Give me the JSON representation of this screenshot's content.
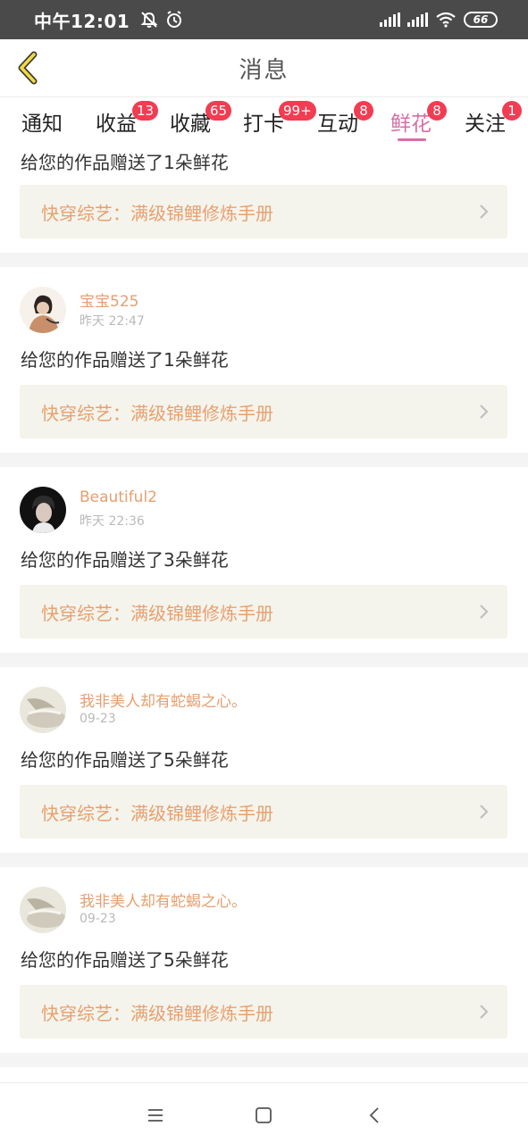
{
  "status_bar": {
    "time": "中午12:01",
    "battery": "66",
    "icons": [
      "mute-icon",
      "alarm-icon",
      "signal-icon",
      "signal-icon",
      "wifi-icon",
      "battery-icon"
    ]
  },
  "header": {
    "title": "消息",
    "back_icon": "chevron-left-icon"
  },
  "tabs": [
    {
      "label": "通知",
      "badge": ""
    },
    {
      "label": "收益",
      "badge": "13"
    },
    {
      "label": "收藏",
      "badge": "65"
    },
    {
      "label": "打卡",
      "badge": "99+"
    },
    {
      "label": "互动",
      "badge": "8"
    },
    {
      "label": "鲜花",
      "badge": "8",
      "active": true
    },
    {
      "label": "关注",
      "badge": "1"
    }
  ],
  "colors": {
    "accent": "#d96ea6",
    "username": "#e59f6f",
    "badge": "#f23c52",
    "link_bg": "#f4f4ec",
    "link_text": "#e8a070"
  },
  "feed": [
    {
      "message": "给您的作品赠送了1朵鲜花",
      "work_title": "快穿综艺：满级锦鲤修炼手册"
    },
    {
      "username": "宝宝525",
      "time": "昨天 22:47",
      "message": "给您的作品赠送了1朵鲜花",
      "work_title": "快穿综艺：满级锦鲤修炼手册"
    },
    {
      "username": "Beautiful2",
      "time": "昨天 22:36",
      "message": "给您的作品赠送了3朵鲜花",
      "work_title": "快穿综艺：满级锦鲤修炼手册"
    },
    {
      "username": "我非美人却有蛇蝎之心。",
      "time": "09-23",
      "message": "给您的作品赠送了5朵鲜花",
      "work_title": "快穿综艺：满级锦鲤修炼手册"
    },
    {
      "username": "我非美人却有蛇蝎之心。",
      "time": "09-23",
      "message": "给您的作品赠送了5朵鲜花",
      "work_title": "快穿综艺：满级锦鲤修炼手册"
    }
  ],
  "nav_bar": {
    "buttons": [
      "menu-icon",
      "home-icon",
      "back-icon"
    ]
  }
}
